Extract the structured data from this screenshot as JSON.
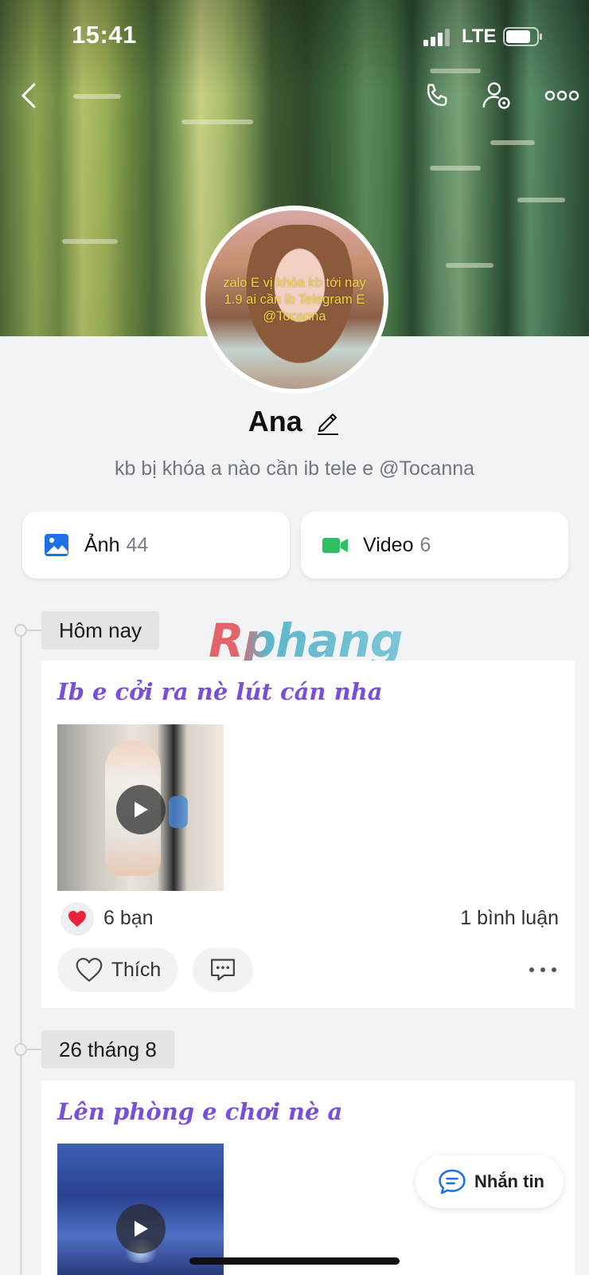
{
  "status_bar": {
    "time": "15:41",
    "network": "LTE"
  },
  "header": {
    "icons": [
      "back-icon",
      "phone-icon",
      "user-settings-icon",
      "more-icon"
    ]
  },
  "profile": {
    "avatar_text": "zalo E vị khóa kb tới nay 1.9 ai cần ib Telegram E @Tocanna",
    "name": "Ana",
    "bio": "kb bị khóa a nào cần ib tele e @Tocanna"
  },
  "media": {
    "photos": {
      "label": "Ảnh",
      "count": "44"
    },
    "videos": {
      "label": "Video",
      "count": "6"
    }
  },
  "watermark": "Rphang",
  "timeline": [
    {
      "date": "Hôm nay",
      "post": {
        "title": "Ib e cởi ra nè lút cán nha",
        "reactions": "6 bạn",
        "comments": "1 bình luận",
        "like_label": "Thích"
      }
    },
    {
      "date": "26 tháng 8",
      "post": {
        "title": "Lên phòng e chơi nè a"
      }
    }
  ],
  "chat_button": {
    "label": "Nhắn tin"
  },
  "colors": {
    "accent_purple": "#7a4fd8",
    "photo_blue": "#1e6fe8",
    "video_green": "#2fbf62",
    "chat_blue": "#1e6fe8"
  }
}
